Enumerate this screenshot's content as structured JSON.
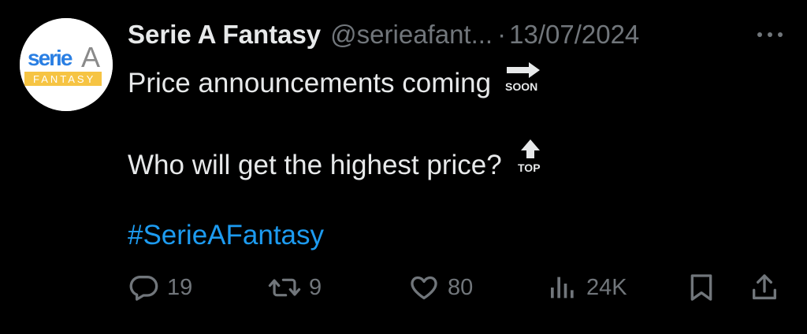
{
  "tweet": {
    "author": {
      "display_name": "Serie A Fantasy",
      "handle": "@serieafant...",
      "avatar": {
        "logo_top": "serie",
        "logo_letter": "A",
        "logo_bottom": "FANTASY",
        "colors": {
          "blue": "#2a7fe3",
          "yellow": "#f6c443",
          "gray": "#8a8a8a"
        }
      }
    },
    "separator": "·",
    "date": "13/07/2024",
    "more_icon": "more-dots-icon",
    "body": {
      "line1": "Price announcements coming",
      "line1_emoji": {
        "name": "soon-arrow-emoji",
        "label": "SOON"
      },
      "line2": "Who will get the highest price?",
      "line2_emoji": {
        "name": "top-arrow-emoji",
        "label": "TOP"
      },
      "hashtag": "#SerieAFantasy"
    },
    "actions": {
      "reply": {
        "icon": "reply-icon",
        "count": "19"
      },
      "retweet": {
        "icon": "retweet-icon",
        "count": "9"
      },
      "like": {
        "icon": "heart-icon",
        "count": "80"
      },
      "views": {
        "icon": "views-icon",
        "count": "24K"
      },
      "bookmark": {
        "icon": "bookmark-icon"
      },
      "share": {
        "icon": "share-icon"
      }
    },
    "colors": {
      "background": "#000000",
      "text": "#e7e9ea",
      "muted": "#71767b",
      "link": "#1d9bf0"
    }
  }
}
